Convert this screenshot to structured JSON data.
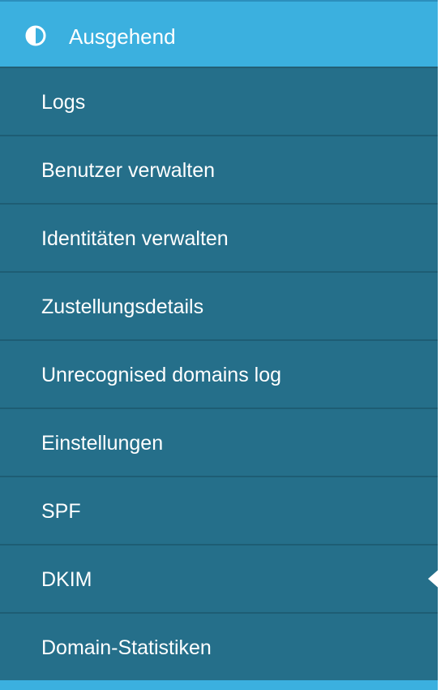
{
  "section": {
    "title": "Ausgehend",
    "icon": "half-circle-icon",
    "accent_color": "#3bb0df"
  },
  "menu": {
    "background_color": "#256f8a",
    "active_index": 7,
    "items": [
      {
        "label": "Logs"
      },
      {
        "label": "Benutzer verwalten"
      },
      {
        "label": "Identitäten verwalten"
      },
      {
        "label": "Zustellungsdetails"
      },
      {
        "label": "Unrecognised domains log"
      },
      {
        "label": "Einstellungen"
      },
      {
        "label": "SPF"
      },
      {
        "label": "DKIM"
      },
      {
        "label": "Domain-Statistiken"
      }
    ]
  }
}
